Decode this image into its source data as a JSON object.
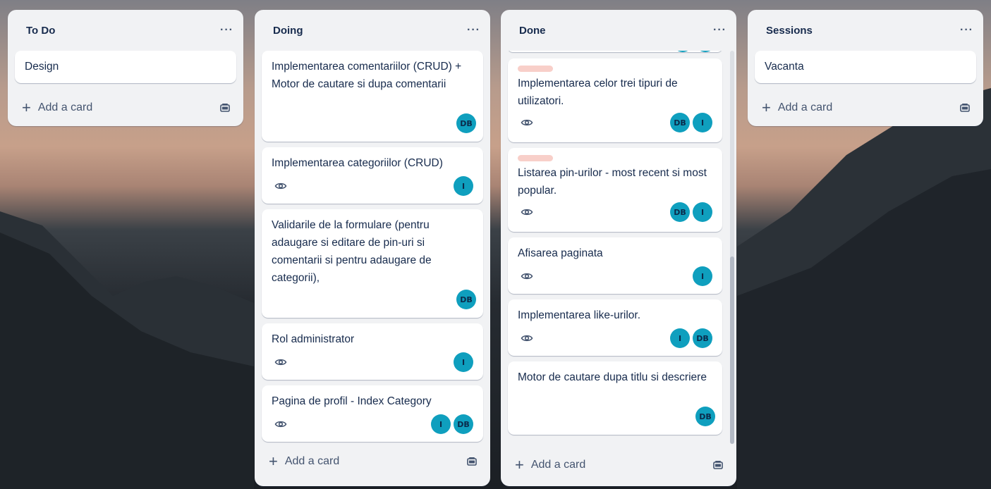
{
  "colors": {
    "list_bg": "#f1f2f4",
    "card_bg": "#ffffff",
    "avatar": "#0f9fbe",
    "label_pink": "#f8cfc9",
    "text": "#172b4d"
  },
  "common": {
    "add_card_label": "Add a card",
    "menu_label": "···",
    "avatar_db": "DB",
    "avatar_i": "I"
  },
  "lists": {
    "todo": {
      "title": "To Do",
      "cards": [
        "Design"
      ]
    },
    "doing": {
      "title": "Doing",
      "cards": [
        "Implementarea comentariilor (CRUD) + Motor de cautare si dupa comentarii",
        "Implementarea categoriilor (CRUD)",
        "Validarile de la formulare (pentru adaugare si editare de pin-uri si comentarii si pentru adaugare de categorii),",
        "Rol administrator",
        "Pagina de profil - Index Category"
      ]
    },
    "done": {
      "title": "Done",
      "cards": [
        "Implementarea celor trei tipuri de utilizatori.",
        "Listarea pin-urilor - most recent si most popular.",
        "Afisarea paginata",
        "Implementarea like-urilor.",
        "Motor de cautare dupa titlu si descriere"
      ]
    },
    "sessions": {
      "title": "Sessions",
      "cards": [
        "Vacanta"
      ]
    }
  }
}
